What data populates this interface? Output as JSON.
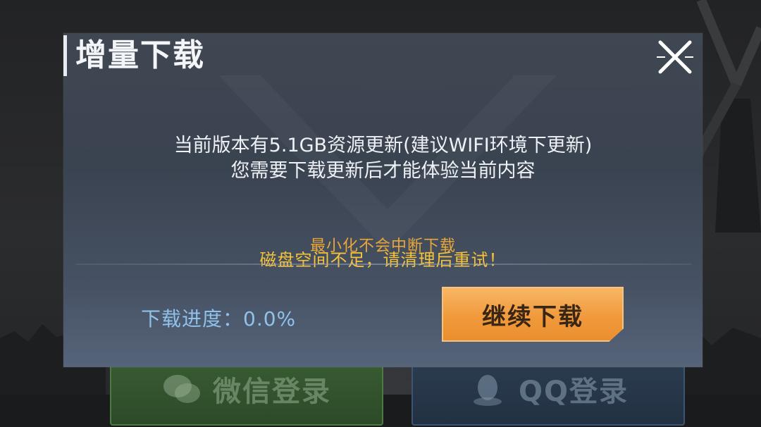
{
  "background": {
    "wechat_login_label": "微信登录",
    "qq_login_label": "QQ登录"
  },
  "dialog": {
    "title": "增量下载",
    "message_line1": "当前版本有5.1GB资源更新(建议WIFI环境下更新)",
    "message_line2": "您需要下载更新后才能体验当前内容",
    "hint_minimize": "最小化不会中断下载",
    "hint_disk": "磁盘空间不足，请清理后重试！",
    "progress_label": "下载进度：",
    "progress_value": "0.0%",
    "continue_button": "继续下载",
    "close_icon": "close-icon"
  },
  "colors": {
    "accent_orange": "#f09a3c",
    "warning_yellow": "#f7c33a",
    "progress_blue": "#8fc1ea",
    "dialog_bg": "#3f4752"
  }
}
